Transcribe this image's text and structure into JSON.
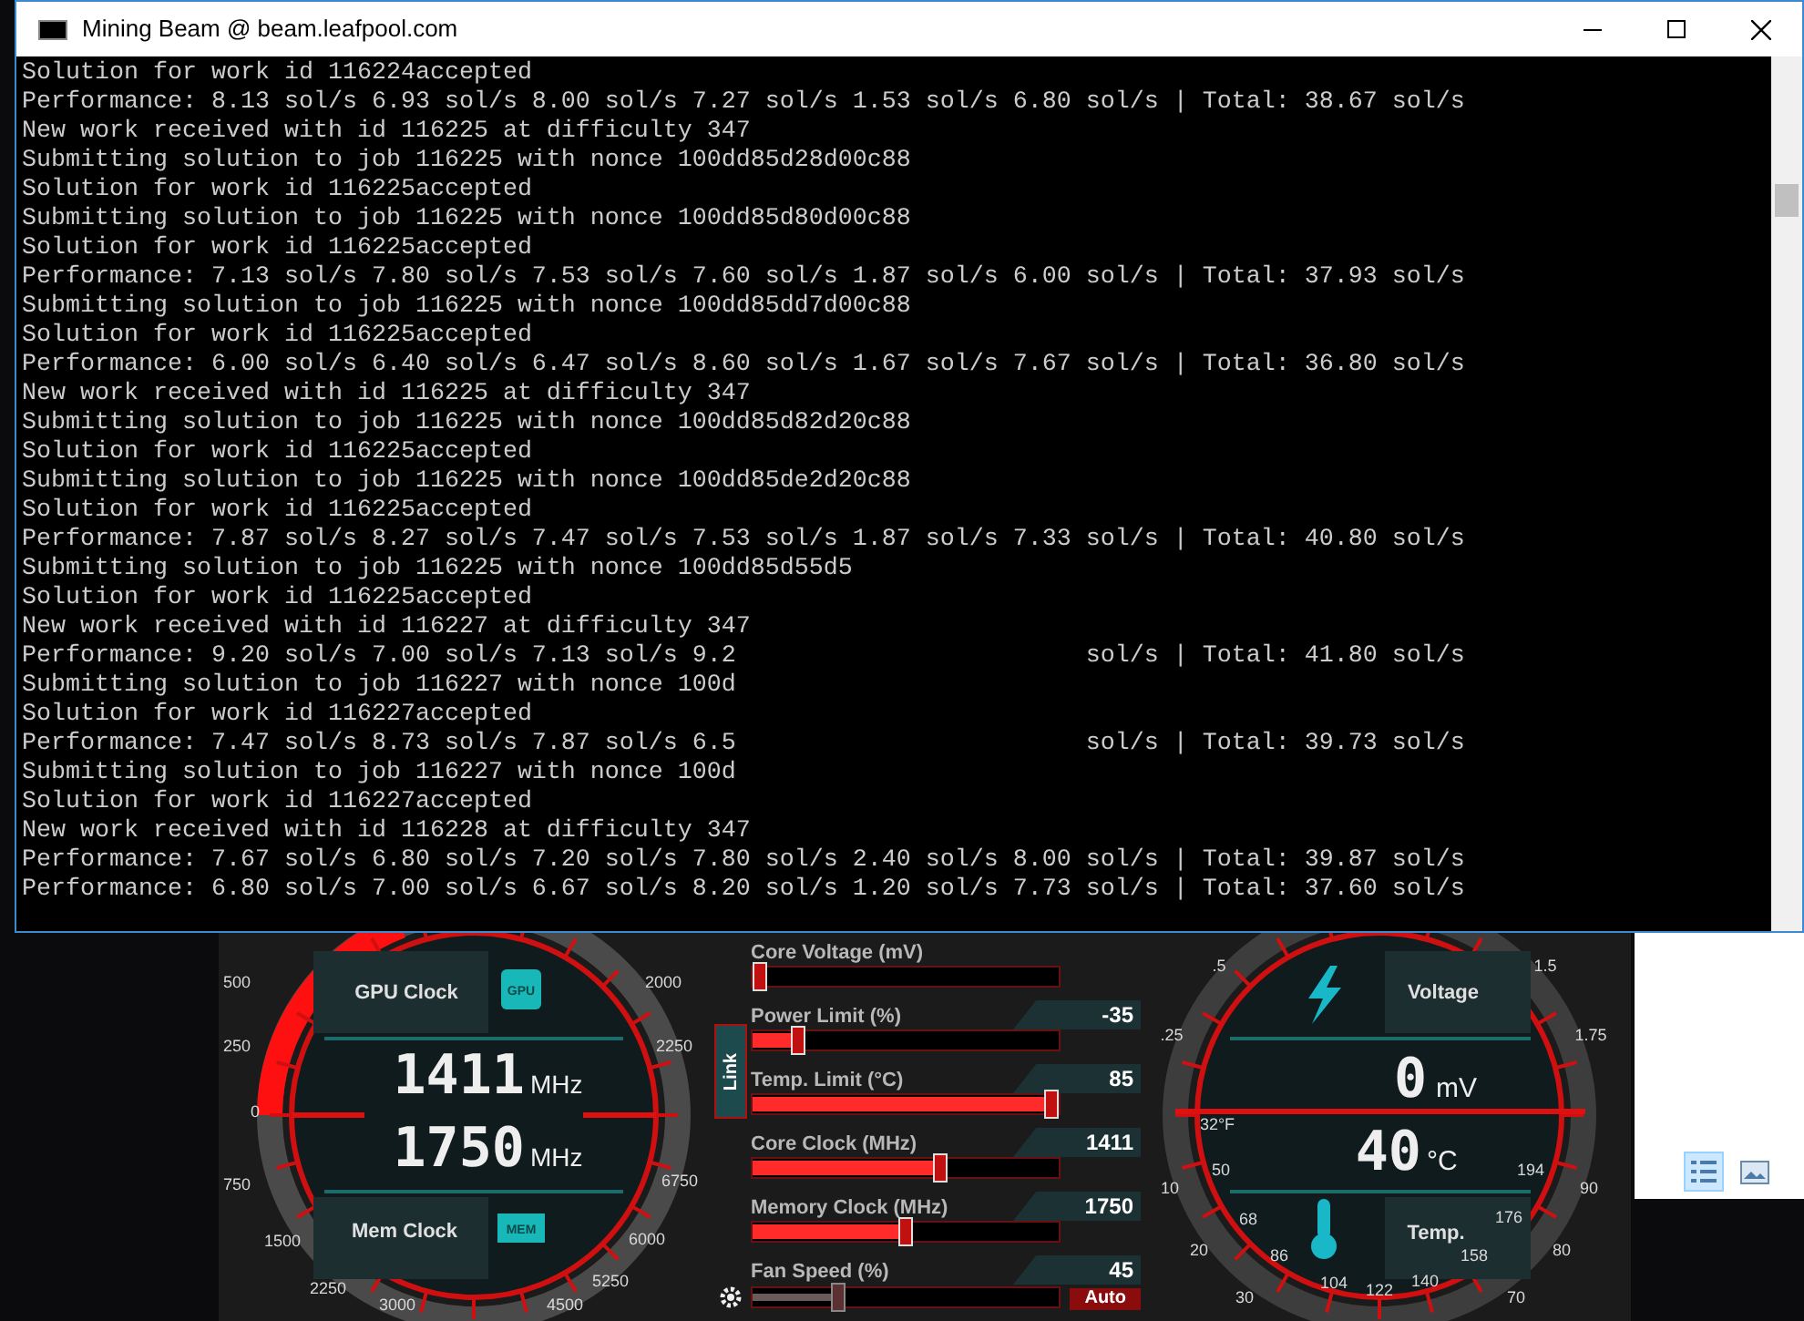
{
  "window": {
    "title": "Mining Beam @ beam.leafpool.com",
    "console_lines": [
      {
        "text": "Solution for work id 116224accepted"
      },
      {
        "text": "Performance: 8.13 sol/s 6.93 sol/s 8.00 sol/s 7.27 sol/s 1.53 sol/s 6.80 sol/s | Total: 38.67 sol/s"
      },
      {
        "text": "New work received with id 116225 at difficulty 347"
      },
      {
        "text": "Submitting solution to job 116225 with nonce 100dd85d28d00c88"
      },
      {
        "text": "Solution for work id 116225accepted"
      },
      {
        "text": "Submitting solution to job 116225 with nonce 100dd85d80d00c88"
      },
      {
        "text": "Solution for work id 116225accepted"
      },
      {
        "text": "Performance: 7.13 sol/s 7.80 sol/s 7.53 sol/s 7.60 sol/s 1.87 sol/s 6.00 sol/s | Total: 37.93 sol/s"
      },
      {
        "text": "Submitting solution to job 116225 with nonce 100dd85dd7d00c88"
      },
      {
        "text": "Solution for work id 116225accepted"
      },
      {
        "text": "Performance: 6.00 sol/s 6.40 sol/s 6.47 sol/s 8.60 sol/s 1.67 sol/s 7.67 sol/s | Total: 36.80 sol/s"
      },
      {
        "text": "New work received with id 116225 at difficulty 347"
      },
      {
        "text": "Submitting solution to job 116225 with nonce 100dd85d82d20c88"
      },
      {
        "text": "Solution for work id 116225accepted"
      },
      {
        "text": "Submitting solution to job 116225 with nonce 100dd85de2d20c88"
      },
      {
        "text": "Solution for work id 116225accepted"
      },
      {
        "text": "Performance: 7.87 sol/s 8.27 sol/s 7.47 sol/s 7.53 sol/s 1.87 sol/s 7.33 sol/s | Total: 40.80 sol/s"
      },
      {
        "text": "Submitting solution to job 116225 with nonce 100dd85d55d5"
      },
      {
        "text": "Solution for work id 116225accepted"
      },
      {
        "text": "New work received with id 116227 at difficulty 347"
      },
      {
        "text": "Performance: 9.20 sol/s 7.00 sol/s 7.13 sol/s 9.2",
        "tail": "sol/s | Total: 41.80 sol/s"
      },
      {
        "text": "Submitting solution to job 116227 with nonce 100d"
      },
      {
        "text": "Solution for work id 116227accepted"
      },
      {
        "text": "Performance: 7.47 sol/s 8.73 sol/s 7.87 sol/s 6.5",
        "tail": "sol/s | Total: 39.73 sol/s"
      },
      {
        "text": "Submitting solution to job 116227 with nonce 100d"
      },
      {
        "text": "Solution for work id 116227accepted"
      },
      {
        "text": "New work received with id 116228 at difficulty 347"
      },
      {
        "text": "Performance: 7.67 sol/s 6.80 sol/s 7.20 sol/s 7.80 sol/s 2.40 sol/s 8.00 sol/s | Total: 39.87 sol/s"
      },
      {
        "text": "Performance: 6.80 sol/s 7.00 sol/s 6.67 sol/s 8.20 sol/s 1.20 sol/s 7.73 sol/s | Total: 37.60 sol/s"
      }
    ]
  },
  "afterburner": {
    "clock_gauge": {
      "top_label": "GPU Clock",
      "top_chip": "GPU",
      "readouts": [
        {
          "value": "1411",
          "unit": "MHz"
        },
        {
          "value": "1750",
          "unit": "MHz"
        }
      ],
      "bottom_label": "Mem Clock",
      "bottom_chip": "MEM",
      "scale_labels": [
        "500",
        "250",
        "0",
        "750",
        "1500",
        "2250",
        "3000",
        "4500",
        "5250",
        "6000",
        "6750",
        "2250",
        "2000"
      ]
    },
    "link": "Link",
    "sliders": [
      {
        "label": "Core Voltage (mV)",
        "level": 0,
        "auto": false
      },
      {
        "label": "Power Limit (%)",
        "value": "-35",
        "level": 0.13,
        "auto": false
      },
      {
        "label": "Temp. Limit (°C)",
        "value": "85",
        "level": 1,
        "auto": false
      },
      {
        "label": "Core Clock (MHz)",
        "value": "1411",
        "level": 0.62,
        "auto": false
      },
      {
        "label": "Memory Clock (MHz)",
        "value": "1750",
        "level": 0.5,
        "auto": false
      },
      {
        "label": "Fan Speed (%)",
        "value": "45",
        "level": 0.27,
        "auto": true
      }
    ],
    "auto_button": "Auto",
    "voltage_gauge": {
      "top_label": "Voltage",
      "readouts": [
        {
          "value": "0",
          "unit": "mV"
        },
        {
          "value": "40",
          "unit": "°C"
        }
      ],
      "bottom_label": "Temp.",
      "scale_labels": [
        ".5",
        ".25",
        "1.5",
        "1.75",
        "32°F",
        "50",
        "10",
        "194",
        "90",
        "68",
        "176",
        "20",
        "86",
        "158",
        "80",
        "30",
        "104",
        "122",
        "140",
        "70"
      ]
    }
  },
  "view_buttons": [
    {
      "kind": "list",
      "selected": true
    },
    {
      "kind": "image",
      "selected": false
    }
  ]
}
